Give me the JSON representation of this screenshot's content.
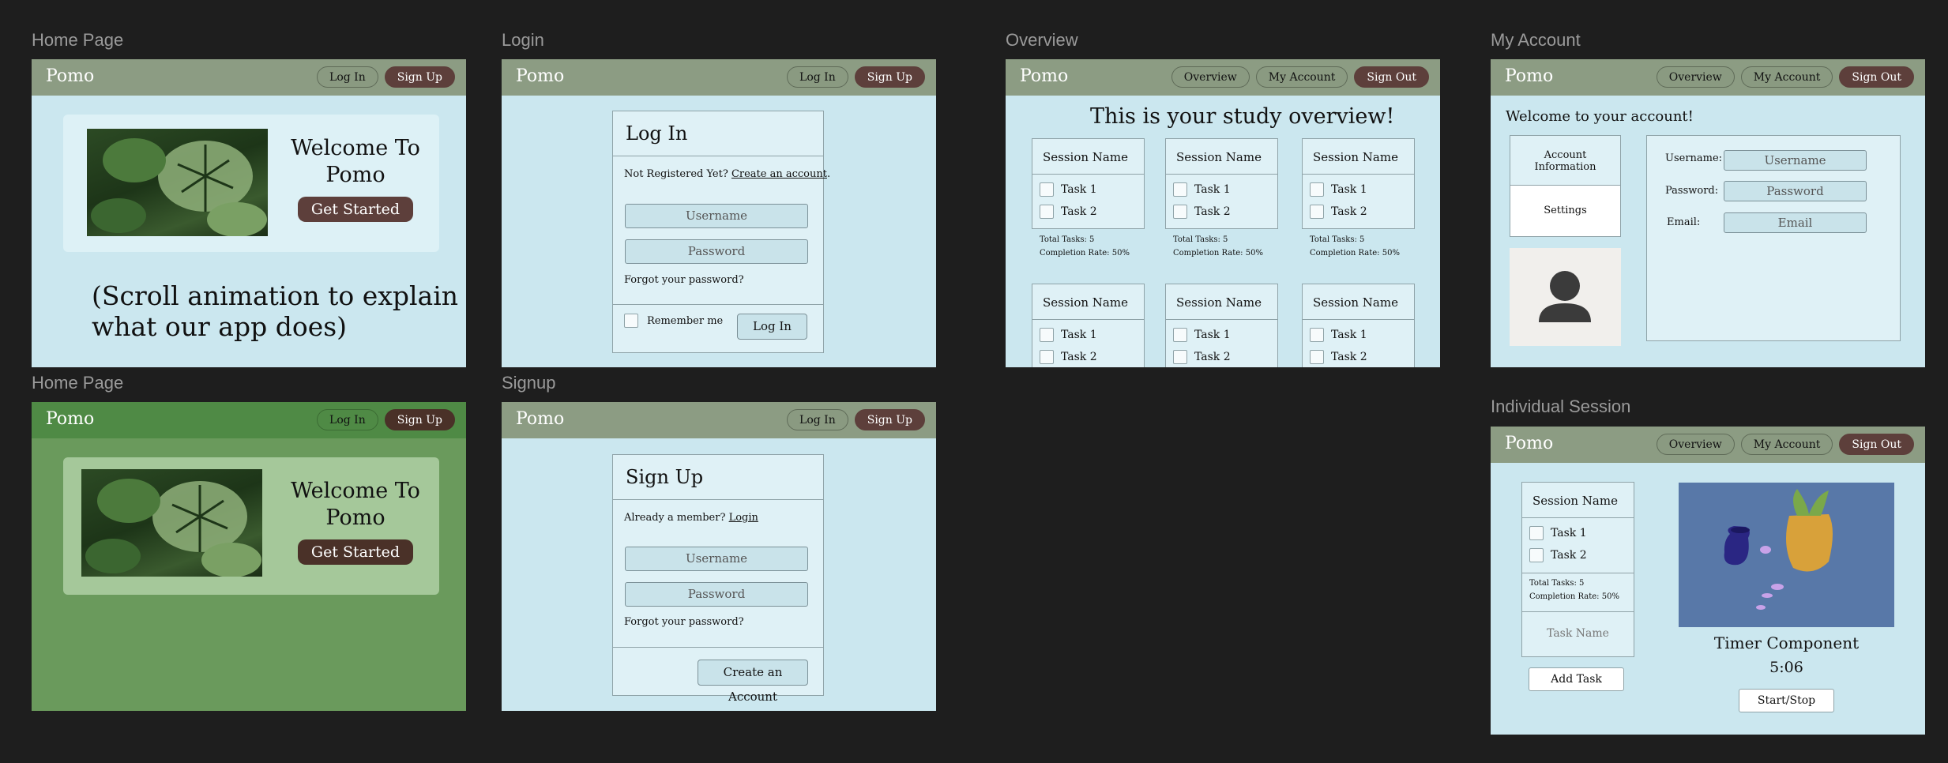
{
  "frames": {
    "home1": {
      "label": "Home Page",
      "logo": "Pomo",
      "nav": [
        "Log In",
        "Sign Up"
      ],
      "welcome_line1": "Welcome To",
      "welcome_line2": "Pomo",
      "cta": "Get Started",
      "scroll_line1": "(Scroll animation to explain",
      "scroll_line2": "what our app does)"
    },
    "home2": {
      "label": "Home Page",
      "logo": "Pomo",
      "nav": [
        "Log In",
        "Sign Up"
      ],
      "welcome_line1": "Welcome To",
      "welcome_line2": "Pomo",
      "cta": "Get Started"
    },
    "login": {
      "label": "Login",
      "logo": "Pomo",
      "nav": [
        "Log In",
        "Sign Up"
      ],
      "title": "Log In",
      "not_registered": "Not Registered Yet?",
      "create_link": "Create an account",
      "period": ".",
      "username_placeholder": "Username",
      "password_placeholder": "Password",
      "forgot": "Forgot your password?",
      "remember": "Remember me",
      "submit": "Log In"
    },
    "signup": {
      "label": "Signup",
      "logo": "Pomo",
      "nav": [
        "Log In",
        "Sign Up"
      ],
      "title": "Sign Up",
      "already": "Already a member?",
      "login_link": "Login",
      "username_placeholder": "Username",
      "password_placeholder": "Password",
      "forgot": "Forgot your password?",
      "submit": "Create an Account"
    },
    "overview": {
      "label": "Overview",
      "logo": "Pomo",
      "nav": [
        "Overview",
        "My Account",
        "Sign Out"
      ],
      "heading": "This is your study overview!",
      "card_title": "Session Name",
      "task1": "Task 1",
      "task2": "Task 2",
      "total": "Total Tasks: 5",
      "rate": "Completion Rate: 50%"
    },
    "account": {
      "label": "My Account",
      "logo": "Pomo",
      "nav": [
        "Overview",
        "My Account",
        "Sign Out"
      ],
      "welcome": "Welcome to your account!",
      "tab_info_1": "Account",
      "tab_info_2": "Information",
      "tab_settings": "Settings",
      "username_label": "Username:",
      "password_label": "Password:",
      "email_label": "Email:",
      "username_value": "Username",
      "password_value": "Password",
      "email_value": "Email"
    },
    "session": {
      "label": "Individual Session",
      "logo": "Pomo",
      "nav": [
        "Overview",
        "My Account",
        "Sign Out"
      ],
      "card_title": "Session Name",
      "task1": "Task 1",
      "task2": "Task 2",
      "total": "Total Tasks: 5",
      "rate": "Completion Rate: 50%",
      "task_name_placeholder": "Task Name",
      "add_task": "Add Task",
      "timer_title": "Timer Component",
      "timer_value": "5:06",
      "start_stop": "Start/Stop"
    }
  },
  "colors": {
    "canvas": "#1e1e1e",
    "frame_bg": "#cbe7ef",
    "nav": "#8c9c83",
    "accent_button": "#5d3f3b",
    "green_frame": "#6a9a5c"
  }
}
